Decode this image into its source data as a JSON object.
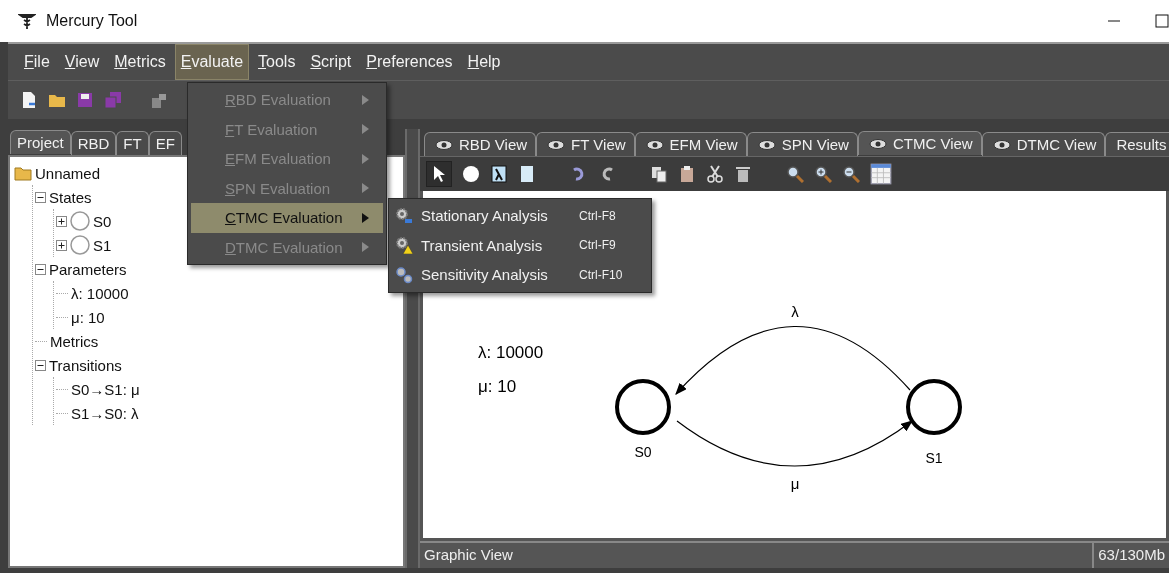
{
  "window": {
    "title": "Mercury Tool"
  },
  "menu_bar": [
    {
      "label": "File",
      "selected": false
    },
    {
      "label": "View",
      "selected": false
    },
    {
      "label": "Metrics",
      "selected": false
    },
    {
      "label": "Evaluate",
      "selected": true
    },
    {
      "label": "Tools",
      "selected": false
    },
    {
      "label": "Script",
      "selected": false
    },
    {
      "label": "Preferences",
      "selected": false
    },
    {
      "label": "Help",
      "selected": false
    }
  ],
  "evaluate_menu": [
    {
      "label": "RBD Evaluation",
      "disabled": true,
      "selected": false
    },
    {
      "label": "FT Evaluation",
      "disabled": true,
      "selected": false
    },
    {
      "label": "EFM Evaluation",
      "disabled": true,
      "selected": false
    },
    {
      "label": "SPN Evaluation",
      "disabled": true,
      "selected": false
    },
    {
      "label": "CTMC Evaluation",
      "disabled": false,
      "selected": true
    },
    {
      "label": "DTMC Evaluation",
      "disabled": true,
      "selected": false
    }
  ],
  "ctmc_submenu": [
    {
      "kind": "stationary",
      "label": "Stationary Analysis",
      "shortcut": "Ctrl-F8"
    },
    {
      "kind": "transient",
      "label": "Transient Analysis",
      "shortcut": "Ctrl-F9"
    },
    {
      "kind": "sensitivity",
      "label": "Sensitivity Analysis",
      "shortcut": "Ctrl-F10"
    }
  ],
  "left_tabs": [
    {
      "label": "Project",
      "selected": true
    },
    {
      "label": "RBD",
      "selected": false
    },
    {
      "label": "FT",
      "selected": false
    },
    {
      "label": "EF",
      "selected": false
    }
  ],
  "project_tree": {
    "label": "Unnamed",
    "kind": "folder",
    "children": [
      {
        "label": "States",
        "kind": "group",
        "expanded": true,
        "children": [
          {
            "label": "S0",
            "kind": "state",
            "expanded": false
          },
          {
            "label": "S1",
            "kind": "state",
            "expanded": false
          }
        ]
      },
      {
        "label": "Parameters",
        "kind": "group",
        "expanded": true,
        "children": [
          {
            "label": "λ: 10000",
            "kind": "leaf"
          },
          {
            "label": "μ: 10",
            "kind": "leaf"
          }
        ]
      },
      {
        "label": "Metrics",
        "kind": "leaf"
      },
      {
        "label": "Transitions",
        "kind": "group",
        "expanded": true,
        "children": [
          {
            "label": "S0→S1: μ",
            "kind": "leaf"
          },
          {
            "label": "S1→S0: λ",
            "kind": "leaf"
          }
        ]
      }
    ]
  },
  "view_tabs": [
    {
      "label": "RBD View",
      "selected": false
    },
    {
      "label": "FT View",
      "selected": false
    },
    {
      "label": "EFM View",
      "selected": false
    },
    {
      "label": "SPN View",
      "selected": false
    },
    {
      "label": "CTMC View",
      "selected": true
    },
    {
      "label": "DTMC View",
      "selected": false
    },
    {
      "label": "Results",
      "selected": false
    }
  ],
  "canvas": {
    "parameters": [
      "λ: 10000",
      "μ: 10"
    ],
    "states": [
      {
        "label": "S0"
      },
      {
        "label": "S1"
      }
    ],
    "transitions": [
      {
        "label": "λ"
      },
      {
        "label": "μ"
      }
    ]
  },
  "status_bar": {
    "text": "Graphic View",
    "memory": "63/130Mb"
  }
}
